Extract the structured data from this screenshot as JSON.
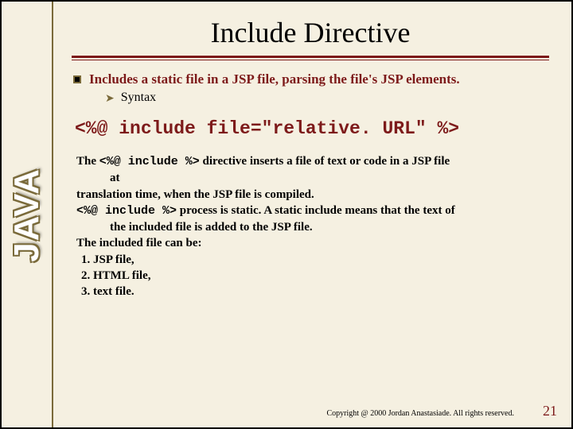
{
  "sidebar": {
    "logo_text": "JAVA"
  },
  "title": "Include Directive",
  "intro": {
    "line": "Includes a static file in a JSP file, parsing the file's JSP elements.",
    "sub": "Syntax"
  },
  "code": "<%@ include file=\"relative. URL\" %>",
  "body": {
    "p1_a": "The ",
    "p1_code": "<%@ include %>",
    "p1_b": " directive inserts a file of text or code in a JSP file",
    "p1_indent": "at",
    "p2": "translation time, when the JSP file is compiled.",
    "p3_code": "<%@ include %>",
    "p3_rest": " process is static. A static include means that the text of",
    "p3_indent": "the included file is added to the JSP file.",
    "p4": "The included file can be:",
    "li1": "1.    JSP file,",
    "li2": "2.    HTML file,",
    "li3": "3.    text file."
  },
  "footer": {
    "copyright": "Copyright @ 2000 Jordan Anastasiade. All rights reserved.",
    "page": "21"
  }
}
